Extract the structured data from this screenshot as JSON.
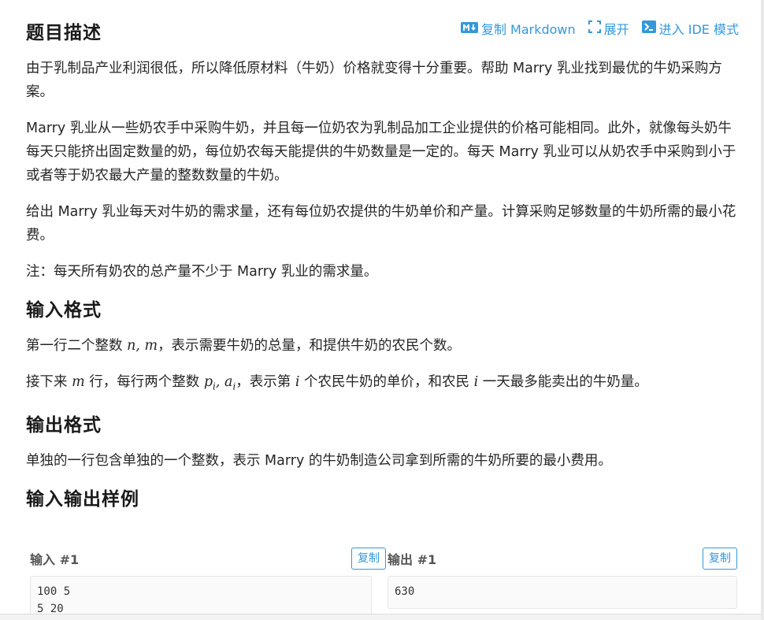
{
  "header": {
    "title": "题目描述",
    "actions": {
      "copy_markdown": "复制 Markdown",
      "expand": "展开",
      "ide_mode": "进入 IDE 模式"
    }
  },
  "description": {
    "p1": "由于乳制品产业利润很低，所以降低原材料（牛奶）价格就变得十分重要。帮助 Marry 乳业找到最优的牛奶采购方案。",
    "p2": "Marry 乳业从一些奶农手中采购牛奶，并且每一位奶农为乳制品加工企业提供的价格可能相同。此外，就像每头奶牛每天只能挤出固定数量的奶，每位奶农每天能提供的牛奶数量是一定的。每天 Marry 乳业可以从奶农手中采购到小于或者等于奶农最大产量的整数数量的牛奶。",
    "p3": "给出 Marry 乳业每天对牛奶的需求量，还有每位奶农提供的牛奶单价和产量。计算采购足够数量的牛奶所需的最小花费。",
    "p4": "注：每天所有奶农的总产量不少于 Marry 乳业的需求量。"
  },
  "input_format": {
    "heading": "输入格式",
    "line1_a": "第一行二个整数 ",
    "line1_math": "n, m",
    "line1_b": "，表示需要牛奶的总量，和提供牛奶的农民个数。",
    "line2_a": "接下来 ",
    "line2_m": "m",
    "line2_b": " 行，每行两个整数 ",
    "line2_p": "p",
    "line2_i1": "i",
    "line2_comma": ", ",
    "line2_a_var": "a",
    "line2_i2": "i",
    "line2_c": "，表示第 ",
    "line2_i3": "i",
    "line2_d": " 个农民牛奶的单价，和农民 ",
    "line2_i4": "i",
    "line2_e": " 一天最多能卖出的牛奶量。"
  },
  "output_format": {
    "heading": "输出格式",
    "text": "单独的一行包含单独的一个整数，表示 Marry 的牛奶制造公司拿到所需的牛奶所要的最小费用。"
  },
  "samples": {
    "heading": "输入输出样例",
    "input_label": "输入 #1",
    "output_label": "输出 #1",
    "copy_label": "复制",
    "input_value": "100 5\n5 20",
    "output_value": "630"
  },
  "colors": {
    "accent": "#3498db",
    "text": "#262626"
  }
}
